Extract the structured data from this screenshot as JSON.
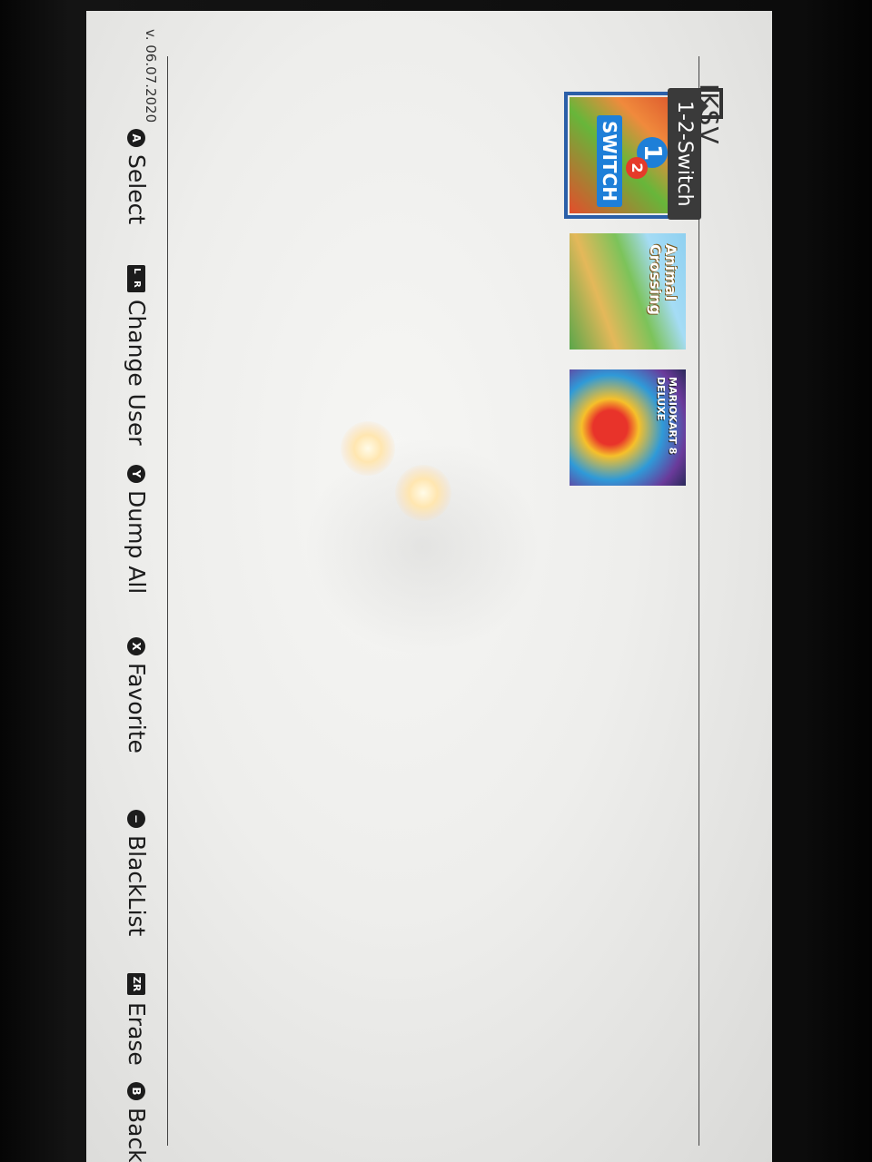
{
  "app": {
    "logo_text": "JKSV",
    "selected_title_tooltip": "1-2-Switch",
    "version": "v. 06.07.2020"
  },
  "titles": [
    {
      "name": "1-2-Switch",
      "art_text_main": "1",
      "art_text_sub": "2",
      "art_word": "SWITCH",
      "selected": true
    },
    {
      "name": "Animal Crossing",
      "art_word": "Animal Crossing",
      "selected": false
    },
    {
      "name": "Mario Kart 8 Deluxe",
      "art_word": "MARIOKART 8 DELUXE",
      "selected": false
    }
  ],
  "hints": [
    {
      "button": "A",
      "label": "Select"
    },
    {
      "button": "L R",
      "label": "Change User"
    },
    {
      "button": "Y",
      "label": "Dump All"
    },
    {
      "button": "X",
      "label": "Favorite"
    },
    {
      "button": "−",
      "label": "BlackList"
    },
    {
      "button": "ZR",
      "label": "Erase"
    },
    {
      "button": "B",
      "label": "Back"
    }
  ],
  "colors": {
    "selection_outline": "#2b5fa8",
    "tooltip_bg": "#3a3a3a",
    "screen_bg": "#eeeeec"
  }
}
